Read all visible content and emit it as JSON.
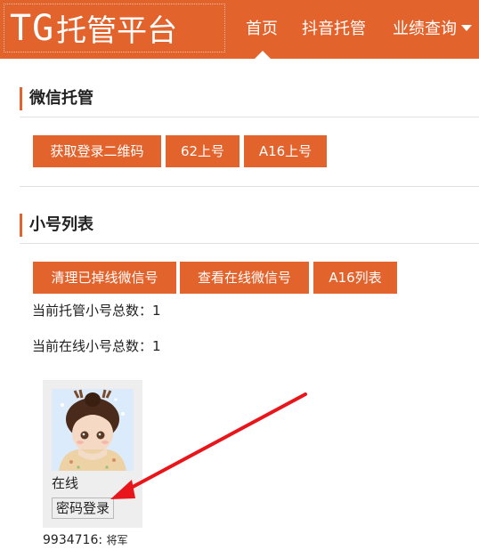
{
  "header": {
    "logo_tg": "TG",
    "logo_name": "托管平台",
    "nav": [
      {
        "label": "首页"
      },
      {
        "label": "抖音托管"
      },
      {
        "label": "业绩查询"
      }
    ]
  },
  "wechat_section": {
    "title": "微信托管",
    "buttons": [
      {
        "label": "获取登录二维码"
      },
      {
        "label": "62上号"
      },
      {
        "label": "A16上号"
      }
    ]
  },
  "account_section": {
    "title": "小号列表",
    "buttons": [
      {
        "label": "清理已掉线微信号"
      },
      {
        "label": "查看在线微信号"
      },
      {
        "label": "A16列表"
      }
    ],
    "total_hosted": "当前托管小号总数：1",
    "total_online": "当前在线小号总数：1"
  },
  "accounts": [
    {
      "status": "在线",
      "login_button": "密码登录",
      "id": "9934716:",
      "rank": "将军"
    }
  ],
  "colors": {
    "brand": "#e3632d",
    "annotation_arrow": "#e8151b"
  },
  "icons": {
    "nav_dropdown": "caret-down-icon",
    "avatar": "cartoon-character-avatar"
  }
}
